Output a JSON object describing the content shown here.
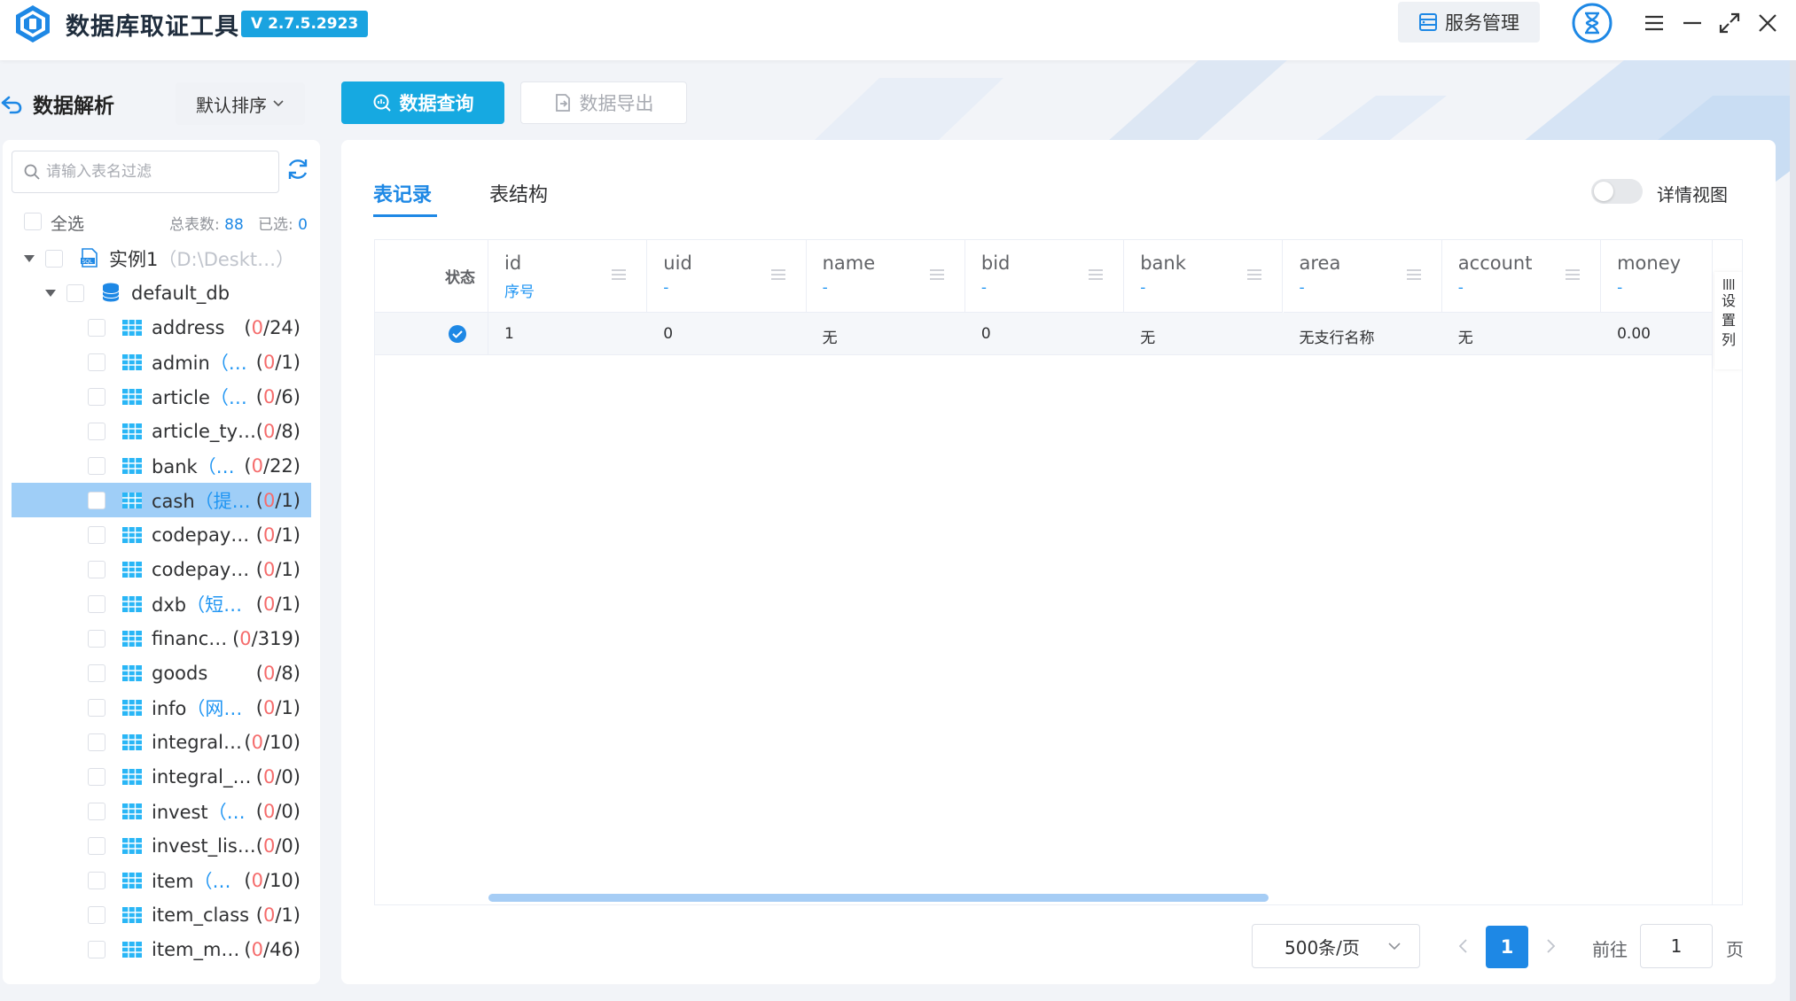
{
  "app": {
    "title": "数据库取证工具",
    "version": "V 2.7.5.2923"
  },
  "header": {
    "service_label": "服务管理"
  },
  "left_panel": {
    "title": "数据解析",
    "sort_label": "默认排序",
    "search_placeholder": "请输入表名过滤",
    "select_all_label": "全选",
    "total_label": "总表数:",
    "total_value": "88",
    "selected_label": "已选:",
    "selected_value": "0",
    "instance": {
      "name": "实例1",
      "path": "（D:\\Deskt…）"
    },
    "database": {
      "name": "default_db"
    },
    "tables": [
      {
        "name": "address",
        "sub": "",
        "done": "0",
        "total": "/24)",
        "selected": false
      },
      {
        "name": "admin",
        "sub": "（…",
        "done": "0",
        "total": "/1)",
        "selected": false
      },
      {
        "name": "article",
        "sub": "（…",
        "done": "0",
        "total": "/6)",
        "selected": false
      },
      {
        "name": "article_ty…",
        "sub": "",
        "done": "0",
        "total": "/8)",
        "selected": false
      },
      {
        "name": "bank",
        "sub": "（…",
        "done": "0",
        "total": "/22)",
        "selected": false
      },
      {
        "name": "cash",
        "sub": "（提…",
        "done": "0",
        "total": "/1)",
        "selected": true
      },
      {
        "name": "codepay…",
        "sub": "",
        "done": "0",
        "total": "/1)",
        "selected": false
      },
      {
        "name": "codepay…",
        "sub": "",
        "done": "0",
        "total": "/1)",
        "selected": false
      },
      {
        "name": "dxb",
        "sub": "（短…",
        "done": "0",
        "total": "/1)",
        "selected": false
      },
      {
        "name": "financ…",
        "sub": "",
        "done": "0",
        "total": "/319)",
        "selected": false
      },
      {
        "name": "goods",
        "sub": "",
        "done": "0",
        "total": "/8)",
        "selected": false
      },
      {
        "name": "info",
        "sub": "（网…",
        "done": "0",
        "total": "/1)",
        "selected": false
      },
      {
        "name": "integral…",
        "sub": "",
        "done": "0",
        "total": "/10)",
        "selected": false
      },
      {
        "name": "integral_…",
        "sub": "",
        "done": "0",
        "total": "/0)",
        "selected": false
      },
      {
        "name": "invest",
        "sub": "（…",
        "done": "0",
        "total": "/0)",
        "selected": false
      },
      {
        "name": "invest_lis…",
        "sub": "",
        "done": "0",
        "total": "/0)",
        "selected": false
      },
      {
        "name": "item",
        "sub": "（…",
        "done": "0",
        "total": "/10)",
        "selected": false
      },
      {
        "name": "item_class",
        "sub": "",
        "done": "0",
        "total": "/1)",
        "selected": false
      },
      {
        "name": "item_m…",
        "sub": "",
        "done": "0",
        "total": "/46)",
        "selected": false
      }
    ]
  },
  "actions": {
    "query_label": "数据查询",
    "export_label": "数据导出"
  },
  "main": {
    "tabs": [
      {
        "label": "表记录",
        "active": true
      },
      {
        "label": "表结构",
        "active": false
      }
    ],
    "detail_view_label": "详情视图",
    "detail_view_on": false,
    "status_header": "状态",
    "column_settings_label": "设置列",
    "columns": [
      {
        "name": "id",
        "sub": "序号"
      },
      {
        "name": "uid",
        "sub": "-"
      },
      {
        "name": "name",
        "sub": "-"
      },
      {
        "name": "bid",
        "sub": "-"
      },
      {
        "name": "bank",
        "sub": "-"
      },
      {
        "name": "area",
        "sub": "-"
      },
      {
        "name": "account",
        "sub": "-"
      },
      {
        "name": "money",
        "sub": "-"
      }
    ],
    "rows": [
      {
        "checked": true,
        "cells": [
          "1",
          "0",
          "无",
          "0",
          "无",
          "无支行名称",
          "无",
          "0.00"
        ]
      }
    ]
  },
  "pagination": {
    "page_size": "500条/页",
    "current_page": "1",
    "goto_label": "前往",
    "goto_value": "1",
    "page_suffix": "页"
  },
  "colors": {
    "accent": "#1e88e5",
    "brand": "#16a9e1",
    "selected_row": "#9fcef7",
    "count_red": "#f56c6c"
  }
}
